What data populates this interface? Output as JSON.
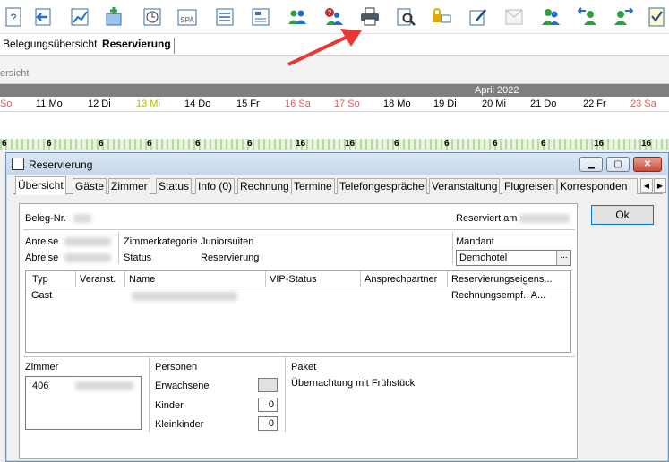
{
  "toolbar": {
    "icons": [
      "help-doc-icon",
      "import-arrow-icon",
      "chart-icon",
      "add-hotel-icon",
      "clock-icon",
      "spa-icon",
      "list-icon",
      "guest-list-icon",
      "group-icon",
      "group-help-icon",
      "print-icon",
      "search-doc-icon",
      "lock-screen-icon",
      "edit-icon",
      "envelope-icon",
      "user-icon",
      "user-import-icon",
      "user-export-icon",
      "document-check-icon"
    ],
    "spa_label": "SPA"
  },
  "app_tabs": [
    "Belegungsübersicht",
    "Reservierung"
  ],
  "subtitle": "ersicht",
  "month": "April 2022",
  "days": [
    {
      "label": "So",
      "color": "#e05c5c"
    },
    {
      "label": "11 Mo",
      "color": "#000"
    },
    {
      "label": "12 Di",
      "color": "#000"
    },
    {
      "label": "13 Mi",
      "color": "#b8b800"
    },
    {
      "label": "14 Do",
      "color": "#000"
    },
    {
      "label": "15 Fr",
      "color": "#000"
    },
    {
      "label": "16 Sa",
      "color": "#e05c5c"
    },
    {
      "label": "17 So",
      "color": "#e05c5c"
    },
    {
      "label": "18 Mo",
      "color": "#000"
    },
    {
      "label": "19 Di",
      "color": "#000"
    },
    {
      "label": "20 Mi",
      "color": "#000"
    },
    {
      "label": "21 Do",
      "color": "#000"
    },
    {
      "label": "22 Fr",
      "color": "#000"
    },
    {
      "label": "23 Sa",
      "color": "#e05c5c"
    }
  ],
  "grid_numbers": [
    "6",
    "6",
    "6",
    "6",
    "6",
    "6",
    "16",
    "16",
    "6",
    "6",
    "6",
    "6",
    "16",
    "16"
  ],
  "dialog": {
    "title": "Reservierung",
    "win_min": "▁",
    "win_max": "▢",
    "win_close": "✕",
    "tabs": [
      "Übersicht",
      "Gäste",
      "Zimmer",
      "Status",
      "Info (0)",
      "Rechnung",
      "Termine",
      "Telefongespräche",
      "Veranstaltung",
      "Flugreisen",
      "Korresponden"
    ],
    "ok_label": "Ok",
    "beleg_label": "Beleg-Nr.",
    "reserviert_label": "Reserviert am",
    "anreise_label": "Anreise",
    "abreise_label": "Abreise",
    "zimmerkategorie_label": "Zimmerkategorie",
    "zimmerkategorie_value": "Juniorsuiten",
    "status_label": "Status",
    "status_value": "Reservierung",
    "mandant_label": "Mandant",
    "mandant_value": "Demohotel",
    "mandant_btn": "...",
    "grid_headers": [
      "Typ",
      "Veranst.",
      "Name",
      "VIP-Status",
      "Ansprechpartner",
      "Reservierungseigens..."
    ],
    "grid_row": {
      "typ": "Gast",
      "reservierung": "Rechnungsempf., A..."
    },
    "zimmer_label": "Zimmer",
    "zimmer_value": "406",
    "personen_label": "Personen",
    "erwachsene_label": "Erwachsene",
    "kinder_label": "Kinder",
    "kinder_value": "0",
    "kleinkinder_label": "Kleinkinder",
    "kleinkinder_value": "0",
    "paket_label": "Paket",
    "paket_value": "Übernachtung mit Frühstück"
  },
  "colors": {
    "accent": "#e53935",
    "weekend": "#e05c5c",
    "grid_green": "#b9d9a3"
  }
}
